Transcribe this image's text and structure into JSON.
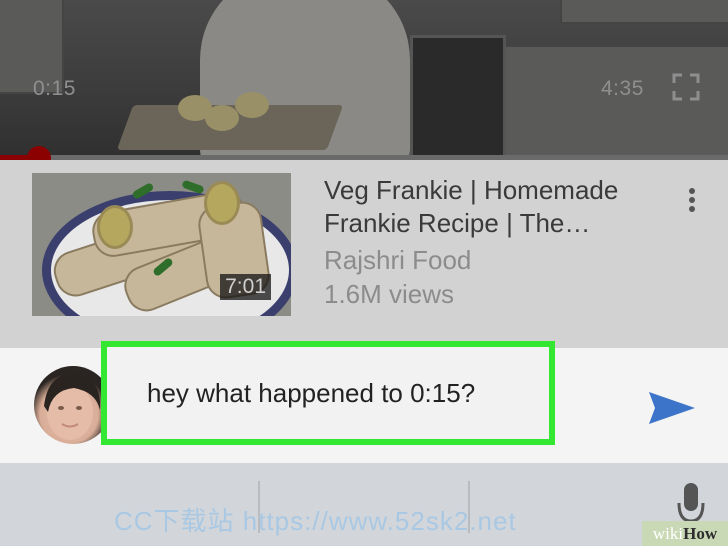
{
  "player": {
    "current_time": "0:15",
    "duration": "4:35",
    "progress_fraction": 0.054
  },
  "video": {
    "title": "Veg Frankie | Homemade Frankie Recipe | The…",
    "channel": "Rajshri Food",
    "views": "1.6M views",
    "thumbnail_duration": "7:01"
  },
  "comment": {
    "text": "hey what happened to 0:15?"
  },
  "watermark": {
    "text": "CC下载站 https://www.52sk2.net",
    "logo_wiki": "wiki",
    "logo_how": "How"
  },
  "colors": {
    "highlight_border": "#33e733",
    "send_icon": "#3b74c9",
    "progress": "#8b0000"
  },
  "icons": [
    "fullscreen-icon",
    "more-vert-icon",
    "send-icon",
    "mic-icon"
  ]
}
